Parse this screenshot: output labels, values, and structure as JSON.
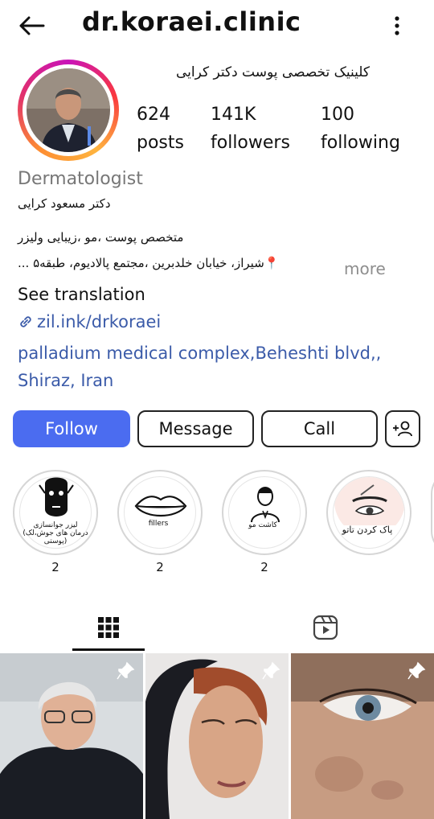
{
  "header": {
    "username": "dr.koraei.clinic"
  },
  "profile": {
    "full_name": "کلینیک تخصصی پوست دکتر کرایی",
    "stats": [
      {
        "value": "624",
        "label": "posts"
      },
      {
        "value": "141K",
        "label": "followers"
      },
      {
        "value": "100",
        "label": "following"
      }
    ],
    "category": "Dermatologist",
    "bio_line1": "دکتر مسعود کرایی",
    "bio_line2": "متخصص پوست ،مو ،زیبایی ولیزر",
    "bio_line3": "📍شیراز، خیابان خلدبرین ،مجتمع پالادیوم، طبقه۵ ...",
    "more": "more",
    "see_translation": "See translation",
    "link": "zil.ink/drkoraei",
    "address": "palladium medical complex,Beheshti blvd,, Shiraz, Iran"
  },
  "actions": {
    "follow": "Follow",
    "message": "Message",
    "call": "Call"
  },
  "highlights": [
    {
      "caption": "لیزر جوانسازی\n(درمان های جوش،لک پوستی)",
      "count": "2",
      "icon": "face-mask-icon"
    },
    {
      "caption": "fillers",
      "count": "2",
      "icon": "lips-icon"
    },
    {
      "caption": "کاشت مو",
      "count": "2",
      "icon": "man-icon"
    },
    {
      "caption": "پاک کردن تاتو",
      "count": "",
      "icon": "eye-brow-icon"
    }
  ],
  "tabs": [
    {
      "name": "grid",
      "icon": "grid-icon",
      "active": true
    },
    {
      "name": "reels",
      "icon": "reels-icon",
      "active": false
    }
  ],
  "colors": {
    "follow": "#4b6cf0",
    "link": "#3b5ba9",
    "muted": "#8e8e8e"
  }
}
